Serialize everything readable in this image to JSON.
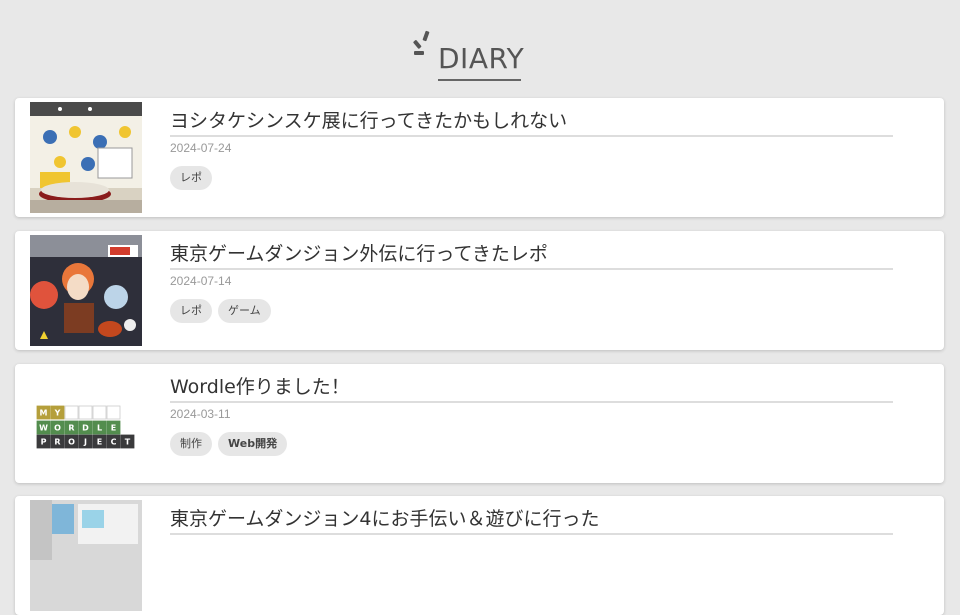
{
  "header": {
    "title": "DIARY"
  },
  "posts": [
    {
      "title": "ヨシタケシンスケ展に行ってきたかもしれない",
      "date": "2024-07-24",
      "tags": [
        "レポ"
      ]
    },
    {
      "title": "東京ゲームダンジョン外伝に行ってきたレポ",
      "date": "2024-07-14",
      "tags": [
        "レポ",
        "ゲーム"
      ]
    },
    {
      "title": "Wordle作りました！",
      "date": "2024-03-11",
      "tags": [
        "制作",
        "Web開発"
      ]
    },
    {
      "title": "東京ゲームダンジョン4にお手伝い＆遊びに行った",
      "date": "",
      "tags": []
    }
  ],
  "wordle_thumb": {
    "rows": [
      {
        "letters": [
          "M",
          "Y",
          "",
          "",
          "",
          ""
        ],
        "colors": [
          "#b59f3b",
          "#b59f3b",
          "#ffffff",
          "#ffffff",
          "#ffffff",
          "#ffffff"
        ]
      },
      {
        "letters": [
          "W",
          "O",
          "R",
          "D",
          "L",
          "E"
        ],
        "colors": [
          "#538d4e",
          "#538d4e",
          "#538d4e",
          "#538d4e",
          "#538d4e",
          "#538d4e"
        ]
      },
      {
        "letters": [
          "P",
          "R",
          "O",
          "J",
          "E",
          "C",
          "T"
        ],
        "colors": [
          "#3a3a3c",
          "#3a3a3c",
          "#3a3a3c",
          "#3a3a3c",
          "#3a3a3c",
          "#3a3a3c",
          "#3a3a3c"
        ]
      }
    ]
  },
  "colors": {
    "background": "#e8e8e8",
    "card": "#ffffff",
    "tag_bg": "#e6e6e6"
  }
}
